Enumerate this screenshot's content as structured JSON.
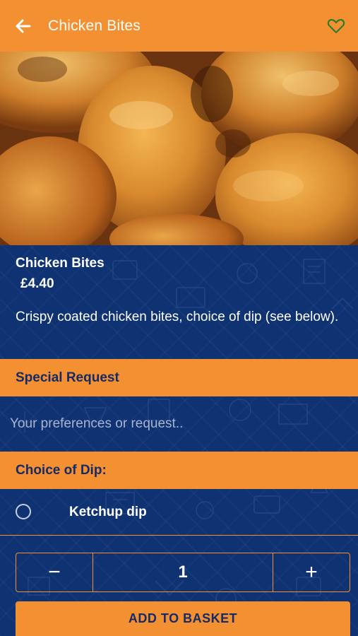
{
  "header": {
    "title": "Chicken Bites",
    "back_icon": "arrow-left-icon",
    "favorite_icon": "heart-outline-icon"
  },
  "hero": {
    "image": "fried-chicken-photo"
  },
  "item": {
    "name": "Chicken Bites",
    "price": "£4.40",
    "description": "Crispy coated chicken bites, choice of dip (see below)."
  },
  "special_request": {
    "heading": "Special Request",
    "placeholder": "Your preferences or request.."
  },
  "dip": {
    "heading": "Choice of Dip:",
    "options": [
      {
        "label": "Ketchup dip",
        "selected": false
      }
    ]
  },
  "stepper": {
    "minus": "−",
    "quantity": "1",
    "plus": "+"
  },
  "add_button": "ADD TO BASKET",
  "colors": {
    "accent": "#f39032",
    "navy": "#0f3272",
    "dark_text": "#152a66",
    "heart": "#2e7d2e"
  }
}
